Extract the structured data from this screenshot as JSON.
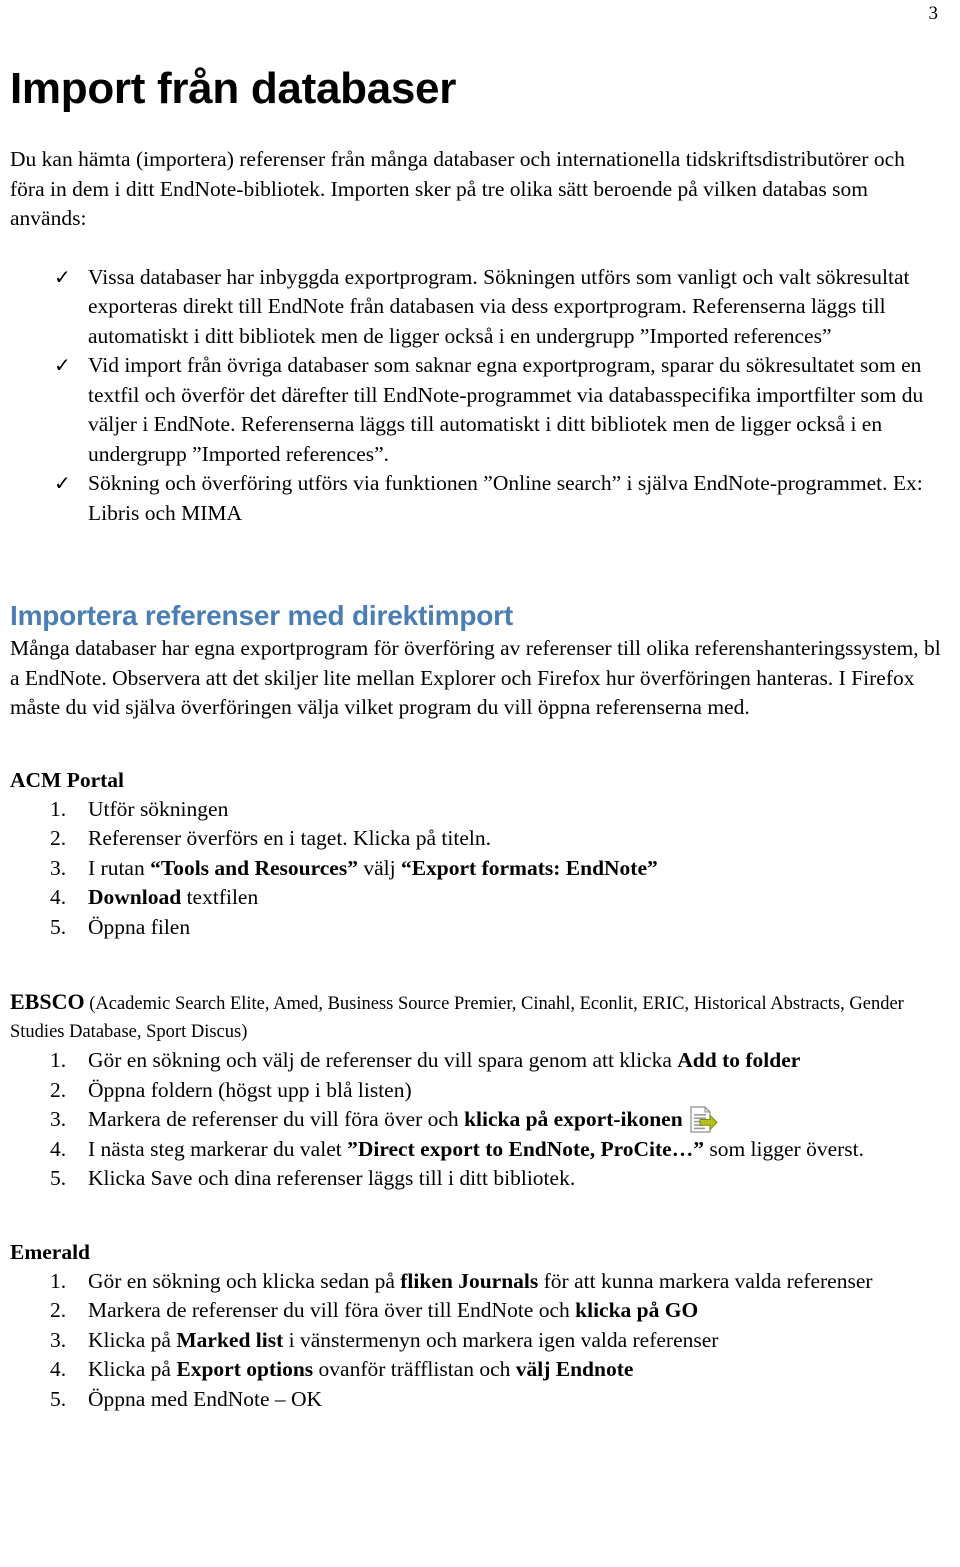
{
  "page": {
    "number": "3",
    "title": "Import från databaser"
  },
  "intro": {
    "paragraph": "Du kan hämta (importera) referenser från många databaser och internationella tidskriftsdistributörer och föra in dem i ditt EndNote-bibliotek. Importen sker på tre olika sätt beroende på vilken databas som används:"
  },
  "check_list": {
    "marker": "✓",
    "items": [
      "Vissa databaser har inbyggda exportprogram. Sökningen utförs som vanligt och valt sökresultat exporteras direkt till EndNote från databasen via dess exportprogram. Referenserna läggs till automatiskt i ditt bibliotek men de ligger också i en undergrupp ”Imported references”",
      "Vid import från övriga databaser som saknar egna exportprogram, sparar du sökresultatet som en textfil och överför det därefter till EndNote-programmet via databasspecifika importfilter som du väljer i EndNote. Referenserna läggs till automatiskt i ditt bibliotek men de ligger också i en undergrupp ”Imported references”.",
      "Sökning och överföring utförs via funktionen ”Online search” i själva EndNote-programmet. Ex: Libris och MIMA"
    ]
  },
  "direct_import": {
    "heading": "Importera referenser med direktimport",
    "heading_color": "#4a7eb4",
    "paragraph": "Många databaser har egna exportprogram för överföring av referenser till olika referenshanteringssystem, bl a EndNote. Observera att det skiljer lite mellan Explorer och Firefox hur överföringen hanteras. I Firefox måste du vid själva överföringen välja vilket program du vill öppna referenserna med."
  },
  "acm": {
    "heading": "ACM Portal",
    "items": [
      {
        "parts": [
          {
            "text": "Utför sökningen",
            "bold": false
          }
        ]
      },
      {
        "parts": [
          {
            "text": "Referenser överförs en i taget. Klicka på titeln.",
            "bold": false
          }
        ]
      },
      {
        "parts": [
          {
            "text": "I rutan ",
            "bold": false
          },
          {
            "text": "“Tools and Resources”",
            "bold": true
          },
          {
            "text": " välj ",
            "bold": false
          },
          {
            "text": "“Export formats: EndNote”",
            "bold": true
          }
        ]
      },
      {
        "parts": [
          {
            "text": "Download",
            "bold": true
          },
          {
            "text": " textfilen",
            "bold": false
          }
        ]
      },
      {
        "parts": [
          {
            "text": "Öppna filen",
            "bold": false
          }
        ]
      }
    ]
  },
  "ebsco": {
    "name": "EBSCO",
    "databases": " (Academic Search Elite, Amed, Business Source Premier, Cinahl, Econlit, ERIC, Historical Abstracts, Gender Studies Database, Sport Discus)",
    "icon_name": "export-icon",
    "items": [
      {
        "parts": [
          {
            "text": "Gör en sökning och välj de referenser du vill spara genom att klicka ",
            "bold": false
          },
          {
            "text": "Add to folder",
            "bold": true
          }
        ]
      },
      {
        "parts": [
          {
            "text": "Öppna foldern (högst upp i blå listen)",
            "bold": false
          }
        ]
      },
      {
        "parts": [
          {
            "text": "Markera de referenser du vill föra över och ",
            "bold": false
          },
          {
            "text": "klicka på export-ikonen",
            "bold": true
          }
        ],
        "has_icon": true
      },
      {
        "parts": [
          {
            "text": "I nästa steg markerar du valet ",
            "bold": false
          },
          {
            "text": "”Direct export to EndNote, ProCite…”",
            "bold": true
          },
          {
            "text": " som ligger överst.",
            "bold": false
          }
        ]
      },
      {
        "parts": [
          {
            "text": "Klicka Save och dina referenser läggs till i ditt bibliotek.",
            "bold": false
          }
        ]
      }
    ]
  },
  "emerald": {
    "heading": "Emerald",
    "items": [
      {
        "parts": [
          {
            "text": "Gör en sökning och klicka sedan på ",
            "bold": false
          },
          {
            "text": "fliken Journals",
            "bold": true
          },
          {
            "text": " för att kunna markera valda referenser",
            "bold": false
          }
        ]
      },
      {
        "parts": [
          {
            "text": "Markera de referenser du vill föra över till EndNote och ",
            "bold": false
          },
          {
            "text": "klicka på GO",
            "bold": true
          }
        ]
      },
      {
        "parts": [
          {
            "text": "Klicka på ",
            "bold": false
          },
          {
            "text": "Marked list",
            "bold": true
          },
          {
            "text": " i vänstermenyn och markera igen valda referenser",
            "bold": false
          }
        ]
      },
      {
        "parts": [
          {
            "text": "Klicka på ",
            "bold": false
          },
          {
            "text": "Export options",
            "bold": true
          },
          {
            "text": " ovanför träfflistan och ",
            "bold": false
          },
          {
            "text": "välj Endnote",
            "bold": true
          }
        ]
      },
      {
        "parts": [
          {
            "text": "Öppna med EndNote – OK",
            "bold": false
          }
        ]
      }
    ]
  }
}
